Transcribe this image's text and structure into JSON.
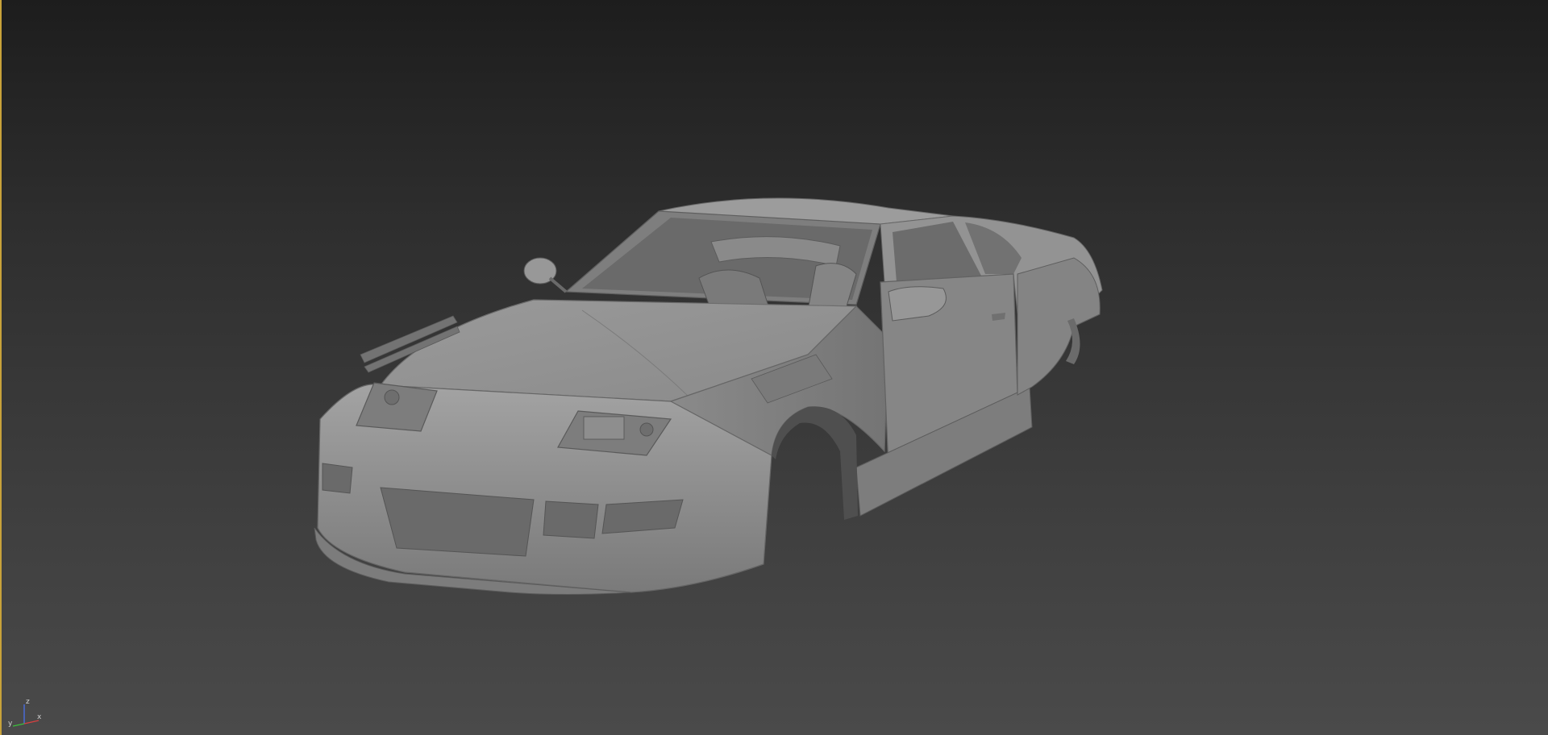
{
  "viewport": {
    "shading": "shaded",
    "background_colors": {
      "top": "#1d1d1d",
      "bottom": "#4a4a4a"
    },
    "active_border_color": "#c8a23a"
  },
  "model": {
    "icon": "car-body-mesh",
    "color": "#8c8c8c"
  },
  "axis_gizmo": {
    "x_label": "x",
    "y_label": "y",
    "z_label": "z",
    "colors": {
      "x": "#d94040",
      "y": "#3cc03c",
      "z": "#4a6ee0"
    }
  }
}
